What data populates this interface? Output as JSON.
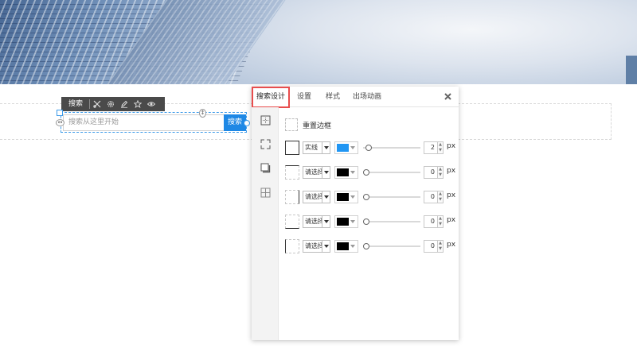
{
  "toolbar": {
    "label": "搜索",
    "icons": [
      "tools-icon",
      "gear-icon",
      "pencil-icon",
      "star-icon",
      "eye-icon"
    ]
  },
  "widget": {
    "placeholder": "搜索从这里开始",
    "button_label": "搜索",
    "accent": "#1e88e5"
  },
  "panel": {
    "tabs": [
      {
        "label": "搜索设计",
        "active": true
      },
      {
        "label": "设置",
        "active": false
      },
      {
        "label": "样式",
        "active": false
      },
      {
        "label": "出场动画",
        "active": false
      }
    ],
    "close_icon": "close-icon",
    "rail_icons": [
      "border-icon",
      "corner-icon",
      "shadow-icon",
      "spacing-icon"
    ],
    "reset_label": "重置边框",
    "unit": "px",
    "borders": [
      {
        "side": "all",
        "style": "实线",
        "color": "#2196f3",
        "width": "2",
        "slider_fraction": 0.04
      },
      {
        "side": "top",
        "style": "请选择",
        "color": "#000000",
        "width": "0",
        "slider_fraction": 0
      },
      {
        "side": "right",
        "style": "请选择",
        "color": "#000000",
        "width": "0",
        "slider_fraction": 0
      },
      {
        "side": "bottom",
        "style": "请选择",
        "color": "#000000",
        "width": "0",
        "slider_fraction": 0
      },
      {
        "side": "left",
        "style": "请选择",
        "color": "#000000",
        "width": "0",
        "slider_fraction": 0
      }
    ]
  },
  "colors": {
    "active_tab_outline": "#e84d4d",
    "toolbar_bg": "#4a4a4a"
  }
}
